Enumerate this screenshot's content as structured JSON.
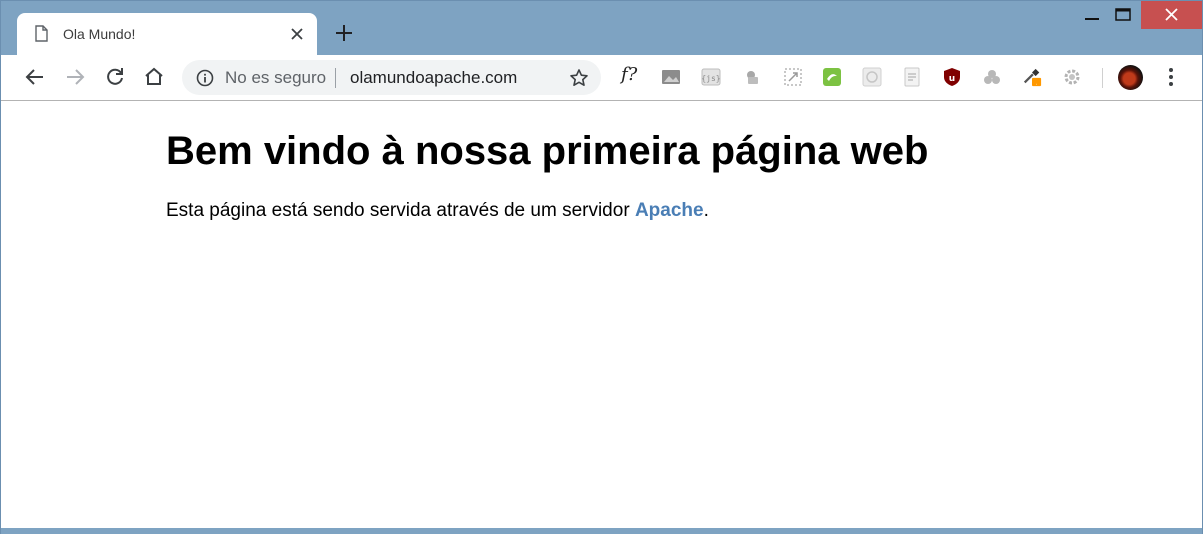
{
  "tab": {
    "title": "Ola Mundo!"
  },
  "omnibox": {
    "security_label": "No es seguro",
    "url": "olamundoapache.com"
  },
  "toolbar": {
    "extension_f_label": "f?"
  },
  "page": {
    "heading": "Bem vindo à nossa primeira página web",
    "paragraph_before": "Esta página está sendo servida através de um servidor ",
    "link_text": "Apache",
    "paragraph_after": "."
  },
  "icons": {
    "tab_page": "page-icon",
    "tab_close": "close-icon",
    "new_tab": "plus-icon",
    "back": "arrow-left-icon",
    "forward": "arrow-right-icon",
    "reload": "reload-icon",
    "home": "home-icon",
    "info": "info-icon",
    "star": "star-icon",
    "menu": "kebab-menu-icon"
  },
  "colors": {
    "frame": "#7ea3c2",
    "close_button": "#c75050",
    "link": "#4a7eb5",
    "omnibox_bg": "#f1f3f4"
  }
}
